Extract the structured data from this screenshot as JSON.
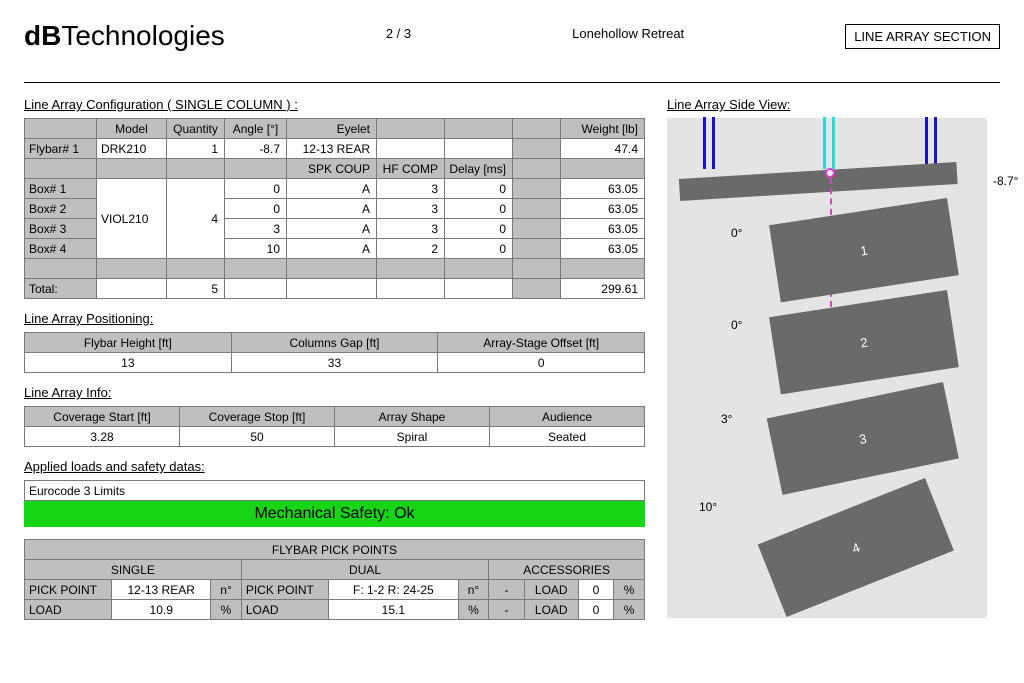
{
  "header": {
    "logo_bold": "dB",
    "logo_rest": "Technologies",
    "page": "2 / 3",
    "venue": "Lonehollow Retreat",
    "section": "LINE ARRAY SECTION"
  },
  "config": {
    "title": "Line Array Configuration ( SINGLE COLUMN ) :",
    "cols": [
      "",
      "Model",
      "Quantity",
      "Angle [°]",
      "Eyelet",
      "",
      "",
      "",
      "Weight [lb]"
    ],
    "flybar_row": [
      "Flybar# 1",
      "DRK210",
      "1",
      "-8.7",
      "12-13 REAR",
      "",
      "",
      "",
      "47.4"
    ],
    "cols2": [
      "",
      "",
      "",
      "",
      "SPK COUP",
      "HF COMP",
      "Delay [ms]",
      "",
      ""
    ],
    "boxes": [
      {
        "label": "Box# 1",
        "angle": "0",
        "coup": "A",
        "hf": "3",
        "delay": "0",
        "wt": "63.05"
      },
      {
        "label": "Box# 2",
        "angle": "0",
        "coup": "A",
        "hf": "3",
        "delay": "0",
        "wt": "63.05"
      },
      {
        "label": "Box# 3",
        "angle": "3",
        "coup": "A",
        "hf": "3",
        "delay": "0",
        "wt": "63.05"
      },
      {
        "label": "Box# 4",
        "angle": "10",
        "coup": "A",
        "hf": "2",
        "delay": "0",
        "wt": "63.05"
      }
    ],
    "box_model": "VIOL210",
    "box_qty": "4",
    "total_label": "Total:",
    "total_qty": "5",
    "total_wt": "299.61"
  },
  "positioning": {
    "title": "Line Array Positioning:",
    "headers": [
      "Flybar Height [ft]",
      "Columns Gap [ft]",
      "Array-Stage Offset [ft]"
    ],
    "values": [
      "13",
      "33",
      "0"
    ]
  },
  "info": {
    "title": "Line Array Info:",
    "headers": [
      "Coverage Start [ft]",
      "Coverage Stop [ft]",
      "Array Shape",
      "Audience"
    ],
    "values": [
      "3.28",
      "50",
      "Spiral",
      "Seated"
    ]
  },
  "safety": {
    "title": "Applied loads and safety datas:",
    "limits": "Eurocode 3 Limits",
    "status": "Mechanical Safety: Ok"
  },
  "pickpoints": {
    "title": "FLYBAR PICK POINTS",
    "groups": [
      "SINGLE",
      "DUAL",
      "ACCESSORIES"
    ],
    "row1": [
      "PICK POINT",
      "12-13 REAR",
      "n°",
      "PICK POINT",
      "F: 1-2 R: 24-25",
      "n°",
      "-",
      "LOAD",
      "0",
      "%"
    ],
    "row2": [
      "LOAD",
      "10.9",
      "%",
      "LOAD",
      "15.1",
      "%",
      "-",
      "LOAD",
      "0",
      "%"
    ]
  },
  "sideview": {
    "title": "Line Array Side View:",
    "flybar_angle": "-8.7°",
    "box_angles": [
      "0°",
      "0°",
      "3°",
      "10°"
    ],
    "box_nums": [
      "1",
      "2",
      "3",
      "4"
    ]
  }
}
